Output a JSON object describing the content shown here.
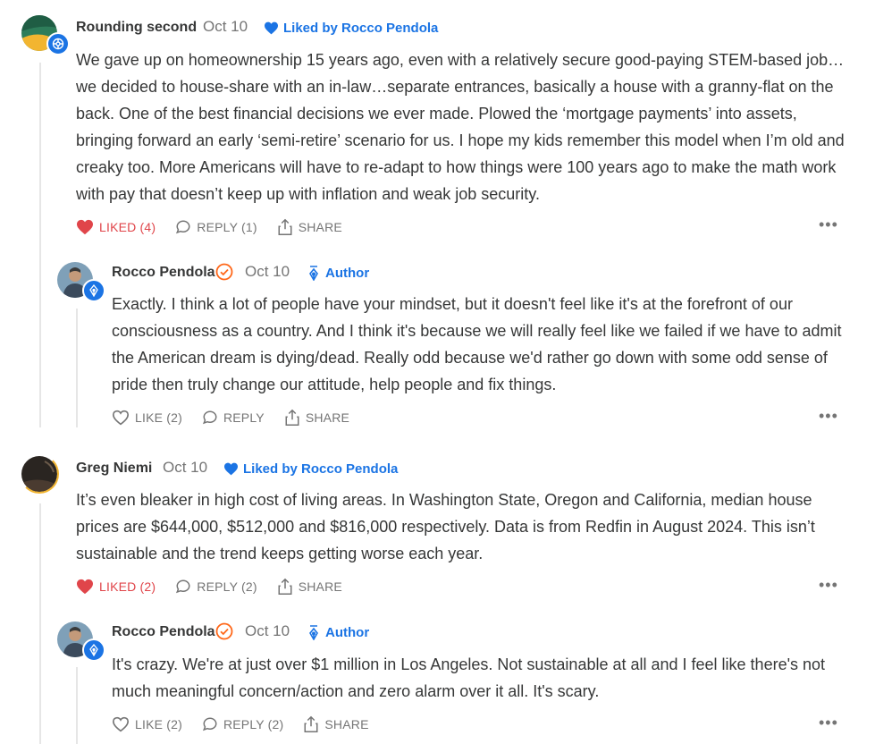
{
  "comments": [
    {
      "name": "Rounding second",
      "date": "Oct 10",
      "liked_by": "Liked by Rocco Pendola",
      "body": "We gave up on homeownership 15 years ago, even with a relatively secure good-paying STEM-based job…we decided to house-share with an in-law…separate entrances, basically a house with a granny-flat on the back. One of the best financial decisions we ever made. Plowed the ‘mortgage payments’ into assets, bringing forward an early ‘semi-retire’ scenario for us. I hope my kids remember this model when I’m old and creaky too. More Americans will have to re-adapt to how things were 100 years ago to make the math work with pay that doesn’t keep up with inflation and weak job security.",
      "like_label": "LIKED (4)",
      "reply_label": "REPLY (1)",
      "share_label": "SHARE",
      "reply": {
        "name": "Rocco Pendola",
        "date": "Oct 10",
        "tag": "Author",
        "body": "Exactly. I think a lot of people have your mindset, but it doesn't feel like it's at the forefront of our consciousness as a country. And I think it's because we will really feel like we failed if we have to admit the American dream is dying/dead. Really odd because we'd rather go down with some odd sense of pride then truly change our attitude, help people and fix things.",
        "like_label": "LIKE (2)",
        "reply_label": "REPLY",
        "share_label": "SHARE"
      }
    },
    {
      "name": "Greg Niemi",
      "date": "Oct 10",
      "liked_by": "Liked by Rocco Pendola",
      "body": "It’s even bleaker in high cost of living areas. In Washington State, Oregon and California, median house prices are $644,000, $512,000 and $816,000 respectively. Data is from Redfin in August 2024. This isn’t sustainable and the trend keeps getting worse each year.",
      "like_label": "LIKED (2)",
      "reply_label": "REPLY (2)",
      "share_label": "SHARE",
      "reply": {
        "name": "Rocco Pendola",
        "date": "Oct 10",
        "tag": "Author",
        "body": "It's crazy. We're at just over $1 million in Los Angeles. Not sustainable at all and I feel like there's not much meaningful concern/action and zero alarm over it all. It's scary.",
        "like_label": "LIKE (2)",
        "reply_label": "REPLY (2)",
        "share_label": "SHARE"
      }
    }
  ],
  "icons": {
    "liked": "heart-filled-icon",
    "like": "heart-outline-icon",
    "reply": "speech-bubble-icon",
    "share": "share-icon",
    "more": "ellipsis-icon",
    "author": "pen-nib-icon",
    "verified": "check-badge-icon"
  },
  "colors": {
    "accent_blue": "#1b74e4",
    "liked_red": "#e0454a",
    "verified_orange": "#ff6719",
    "muted": "#757575",
    "text": "#363737"
  }
}
